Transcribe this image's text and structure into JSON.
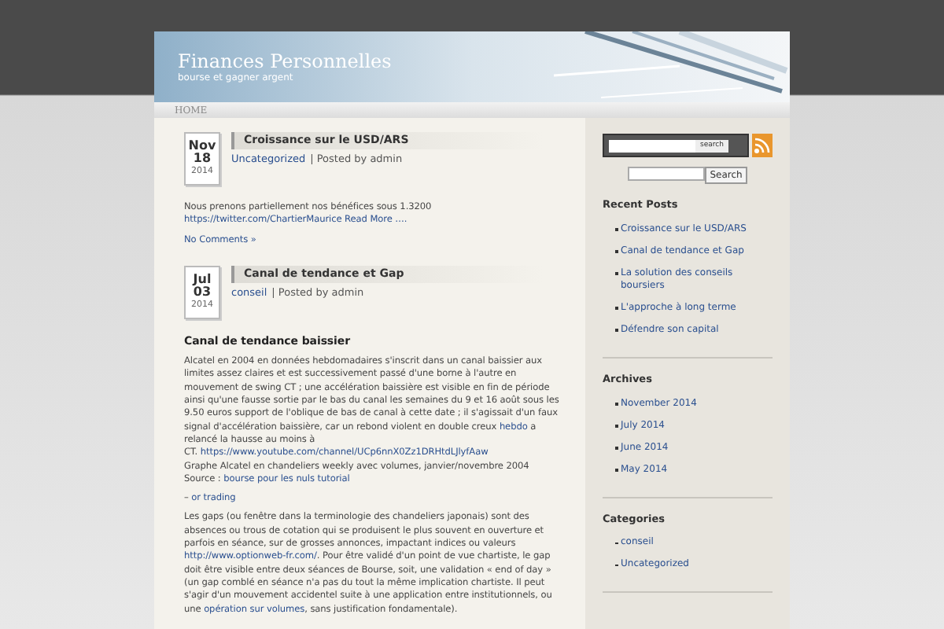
{
  "header": {
    "title": "Finances Personnelles",
    "tagline": "bourse et gagner argent"
  },
  "nav": [
    {
      "label": "HOME",
      "selected": true
    }
  ],
  "posts": [
    {
      "month": "Nov",
      "day": "18",
      "year": "2014",
      "title": "Croissance sur le USD/ARS",
      "category": "Uncategorized",
      "byline": "| Posted by admin",
      "body": [
        {
          "kind": "paragraph",
          "segments": [
            {
              "kind": "text",
              "text": "Nous prenons partiellement nos bénéfices sous 1.3200"
            },
            {
              "kind": "break"
            },
            {
              "kind": "link",
              "text": "https://twitter.com/ChartierMaurice Read More …."
            }
          ]
        }
      ],
      "comments": "No Comments »"
    },
    {
      "month": "Jul",
      "day": "03",
      "year": "2014",
      "title": "Canal de tendance et Gap",
      "category": "conseil",
      "byline": "| Posted by admin",
      "body": [
        {
          "kind": "heading",
          "segments": [
            {
              "kind": "text",
              "text": "Canal de tendance baissier"
            }
          ]
        },
        {
          "kind": "paragraph",
          "segments": [
            {
              "kind": "text",
              "text": "Alcatel en 2004 en données hebdomadaires s'inscrit dans un canal baissier aux limites assez claires et est successivement passé d'une borne à l'autre en mouvement de swing CT ; une accélération baissière est visible en fin de période ainsi qu'une fausse sortie par le bas du canal les semaines du 9 et 16 août sous les 9.50 euros support de l'oblique de bas de canal à cette date ; il s'agissait d'un faux signal d'accélération baissière, car un rebond violent en double creux "
            },
            {
              "kind": "link",
              "text": "hebdo"
            },
            {
              "kind": "text",
              "text": " a relancé la hausse au moins à"
            },
            {
              "kind": "break"
            },
            {
              "kind": "text",
              "text": "CT. "
            },
            {
              "kind": "link",
              "text": "https://www.youtube.com/channel/UCp6nnX0Zz1DRHtdLJlyfAaw"
            },
            {
              "kind": "break"
            },
            {
              "kind": "text",
              "text": "Graphe Alcatel en chandeliers weekly avec volumes, janvier/novembre 2004"
            },
            {
              "kind": "break"
            },
            {
              "kind": "text",
              "text": "Source : "
            },
            {
              "kind": "link",
              "text": "bourse pour les nuls tutorial"
            }
          ]
        },
        {
          "kind": "paragraph",
          "segments": [
            {
              "kind": "text",
              "text": "– "
            },
            {
              "kind": "link",
              "text": "or trading"
            }
          ]
        },
        {
          "kind": "paragraph",
          "segments": [
            {
              "kind": "text",
              "text": "Les gaps (ou fenêtre dans la terminologie des chandeliers japonais) sont des absences ou trous de cotation qui se produisent le plus souvent en ouverture et parfois en séance, sur de grosses annonces, impactant indices ou valeurs "
            },
            {
              "kind": "link",
              "text": "http://www.optionweb-fr.com/"
            },
            {
              "kind": "text",
              "text": ". Pour être validé d'un point de vue chartiste, le gap doit être visible entre deux séances de Bourse, soit, une validation « end of day » (un gap comblé en séance n'a pas du tout la même implication chartiste. Il peut s'agir d'un mouvement accidentel suite à une application entre institutionnels, ou une "
            },
            {
              "kind": "link",
              "text": "opération sur volumes"
            },
            {
              "kind": "text",
              "text": ", sans justification fondamentale)."
            }
          ]
        }
      ]
    }
  ],
  "sidebar": {
    "top_search_button": "search",
    "search_button": "Search",
    "sections": [
      {
        "title": "Recent Posts",
        "items": [
          "Croissance sur le USD/ARS",
          "Canal de tendance et Gap",
          "La solution des conseils boursiers",
          "L'approche à long terme",
          "Défendre son capital"
        ]
      },
      {
        "title": "Archives",
        "items": [
          "November 2014",
          "July 2014",
          "June 2014",
          "May 2014"
        ]
      },
      {
        "title": "Categories",
        "items": [
          "conseil",
          "Uncategorized"
        ]
      }
    ]
  }
}
